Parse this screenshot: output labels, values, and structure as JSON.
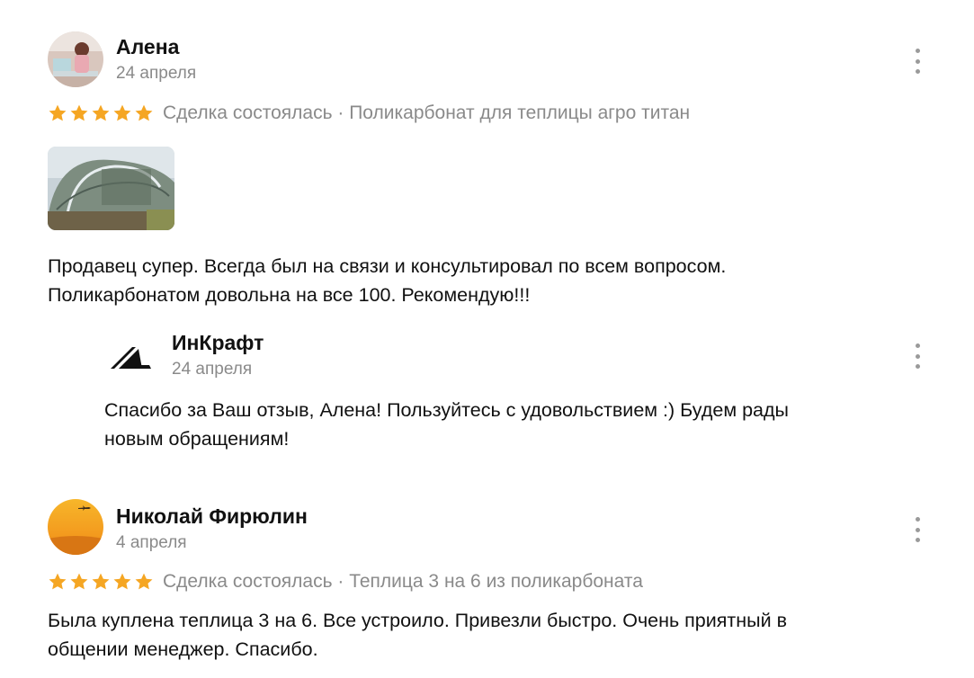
{
  "reviews": [
    {
      "author": "Алена",
      "date": "24 апреля",
      "rating": 5,
      "meta": "Сделка состоялась · Поликарбонат для теплицы агро титан",
      "text_lines": [
        "Продавец супер. Всегда был на связи и консультировал по всем вопросом.",
        "Поликарбонатом довольна на все 100. Рекомендую!!!"
      ],
      "reply": {
        "author": "ИнКрафт",
        "date": "24 апреля",
        "text_lines": [
          "Спасибо за Ваш отзыв, Алена! Пользуйтесь с удовольствием :) Будем рады",
          "новым обращениям!"
        ]
      }
    },
    {
      "author": "Николай Фирюлин",
      "date": "4 апреля",
      "rating": 5,
      "meta": "Сделка состоялась · Теплица 3 на 6 из поликарбоната",
      "text_lines": [
        "Была куплена теплица 3 на 6. Все устроило. Привезли быстро. Очень приятный в",
        "общении менеджер. Спасибо."
      ]
    }
  ],
  "colors": {
    "star": "#f5a623",
    "muted": "#8a8a8a",
    "text": "#111111"
  },
  "icons": {
    "more": "more-vertical-icon",
    "star": "star-icon"
  }
}
